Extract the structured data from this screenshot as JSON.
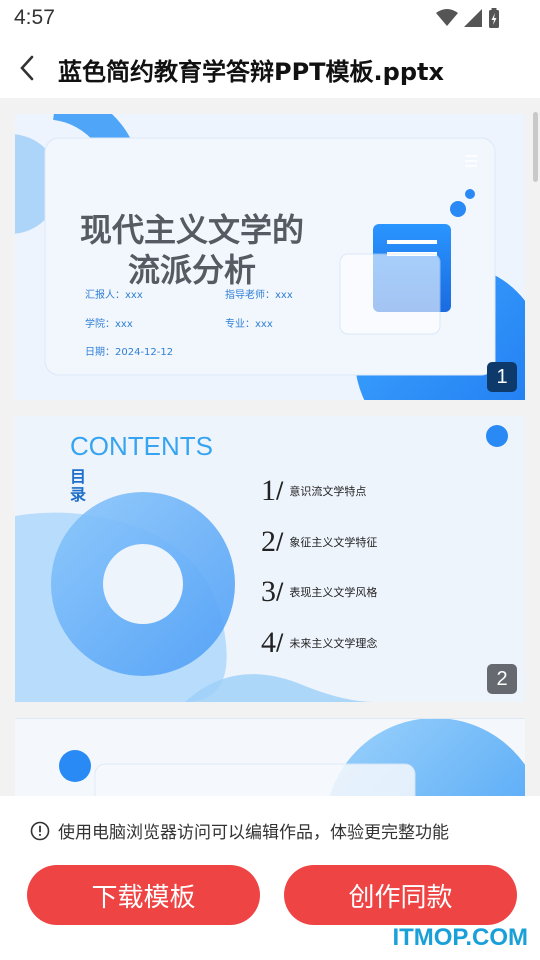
{
  "status_bar": {
    "time": "4:57"
  },
  "header": {
    "title": "蓝色简约教育学答辩PPT模板.pptx"
  },
  "slides": [
    {
      "number": "1",
      "title_line1": "现代主义文学的",
      "title_line2": "流派分析",
      "reporter": "汇报人：xxx",
      "advisor": "指导老师：xxx",
      "college": "学院：xxx",
      "major": "专业：xxx",
      "date": "日期：2024-12-12"
    },
    {
      "number": "2",
      "heading": "CONTENTS",
      "subheading": "目录",
      "items": [
        {
          "num": "1",
          "text": "意识流文学特点"
        },
        {
          "num": "2",
          "text": "象征主义文学特征"
        },
        {
          "num": "3",
          "text": "表现主义文学风格"
        },
        {
          "num": "4",
          "text": "未来主义文学理念"
        }
      ]
    }
  ],
  "bottom": {
    "notice": "使用电脑浏览器访问可以编辑作品，体验更完整功能",
    "download_label": "下载模板",
    "create_label": "创作同款"
  },
  "watermark": "ITMOP.COM",
  "colors": {
    "accent_red": "#ef4444",
    "brand_blue": "#2f8cf5"
  }
}
